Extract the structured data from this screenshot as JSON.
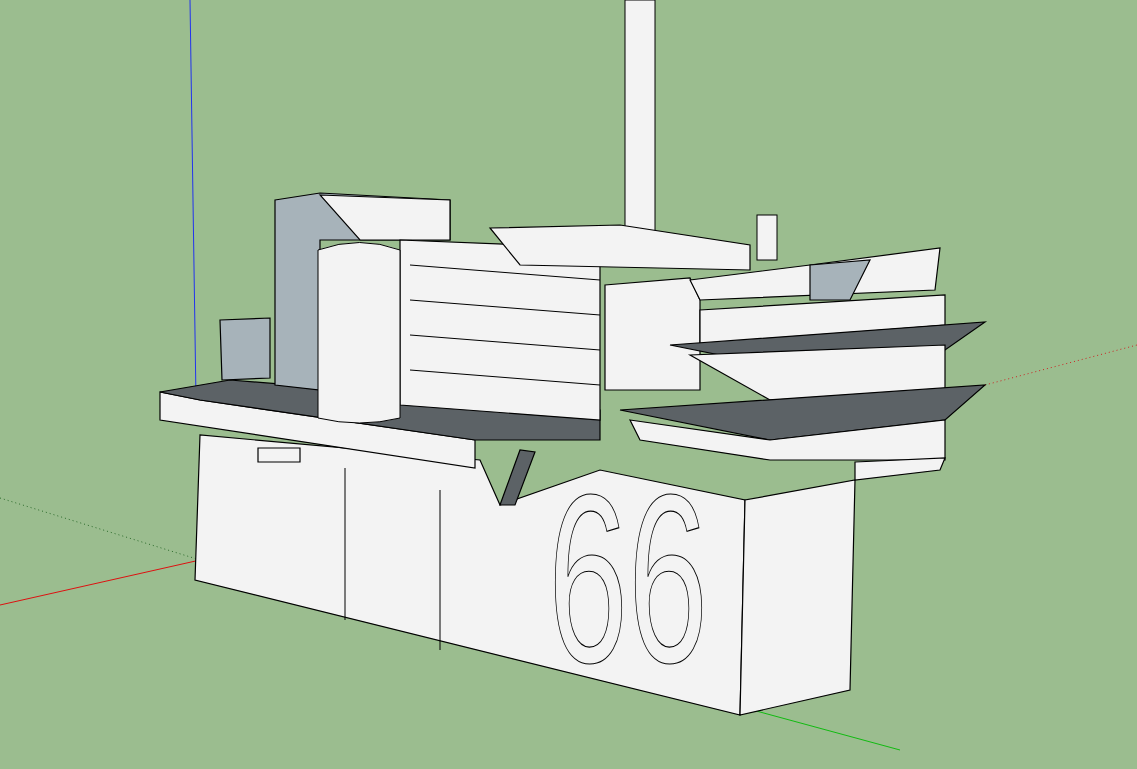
{
  "viewport": {
    "model": {
      "hull_number": "66"
    }
  }
}
